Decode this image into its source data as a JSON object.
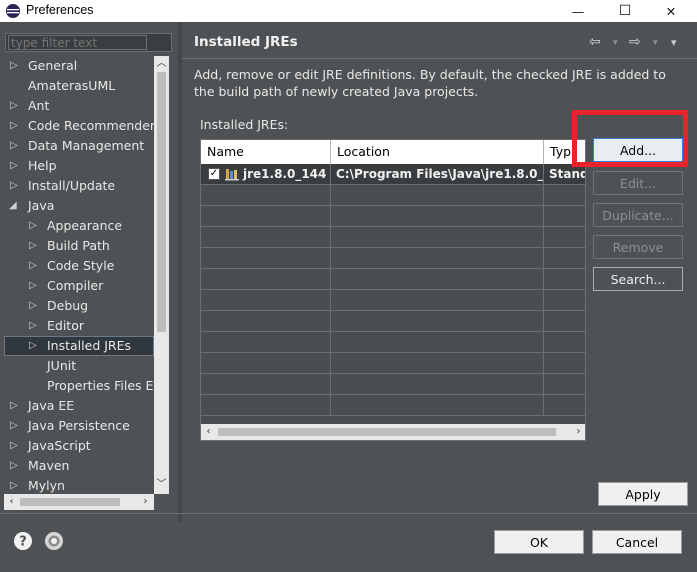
{
  "window": {
    "title": "Preferences",
    "minimize": "—",
    "maximize": "☐",
    "close": "✕"
  },
  "sidebar": {
    "filter_placeholder": "type filter text",
    "items": [
      {
        "label": "General",
        "level": 0,
        "expander": "collapsed"
      },
      {
        "label": "AmaterasUML",
        "level": 0,
        "expander": "none"
      },
      {
        "label": "Ant",
        "level": 0,
        "expander": "collapsed"
      },
      {
        "label": "Code Recommenders",
        "level": 0,
        "expander": "collapsed"
      },
      {
        "label": "Data Management",
        "level": 0,
        "expander": "collapsed"
      },
      {
        "label": "Help",
        "level": 0,
        "expander": "collapsed"
      },
      {
        "label": "Install/Update",
        "level": 0,
        "expander": "collapsed"
      },
      {
        "label": "Java",
        "level": 0,
        "expander": "expanded"
      },
      {
        "label": "Appearance",
        "level": 1,
        "expander": "collapsed"
      },
      {
        "label": "Build Path",
        "level": 1,
        "expander": "collapsed"
      },
      {
        "label": "Code Style",
        "level": 1,
        "expander": "collapsed"
      },
      {
        "label": "Compiler",
        "level": 1,
        "expander": "collapsed"
      },
      {
        "label": "Debug",
        "level": 1,
        "expander": "collapsed"
      },
      {
        "label": "Editor",
        "level": 1,
        "expander": "collapsed"
      },
      {
        "label": "Installed JREs",
        "level": 1,
        "expander": "collapsed",
        "selected": true
      },
      {
        "label": "JUnit",
        "level": 1,
        "expander": "none"
      },
      {
        "label": "Properties Files Ed",
        "level": 1,
        "expander": "none"
      },
      {
        "label": "Java EE",
        "level": 0,
        "expander": "collapsed"
      },
      {
        "label": "Java Persistence",
        "level": 0,
        "expander": "collapsed"
      },
      {
        "label": "JavaScript",
        "level": 0,
        "expander": "collapsed"
      },
      {
        "label": "Maven",
        "level": 0,
        "expander": "collapsed"
      },
      {
        "label": "Mylyn",
        "level": 0,
        "expander": "collapsed"
      }
    ]
  },
  "page": {
    "title": "Installed JREs",
    "nav_back": "⇦",
    "nav_forward": "⇨",
    "nav_menu": "▾",
    "description": "Add, remove or edit JRE definitions. By default, the checked JRE is added to the build path of newly created Java projects.",
    "table_label": "Installed JREs:",
    "table": {
      "columns": [
        "Name",
        "Location",
        "Typ"
      ],
      "rows": [
        {
          "checked": true,
          "name": "jre1.8.0_144 ...",
          "location": "C:\\Program Files\\Java\\jre1.8.0_",
          "type": "Standa"
        }
      ]
    },
    "buttons": {
      "add": "Add...",
      "edit": "Edit...",
      "duplicate": "Duplicate...",
      "remove": "Remove",
      "search": "Search...",
      "apply": "Apply"
    }
  },
  "footer": {
    "ok": "OK",
    "cancel": "Cancel"
  },
  "colors": {
    "background": "#4f5254",
    "highlight_box": "#e8232b",
    "focus_border": "#3b7bd4"
  }
}
